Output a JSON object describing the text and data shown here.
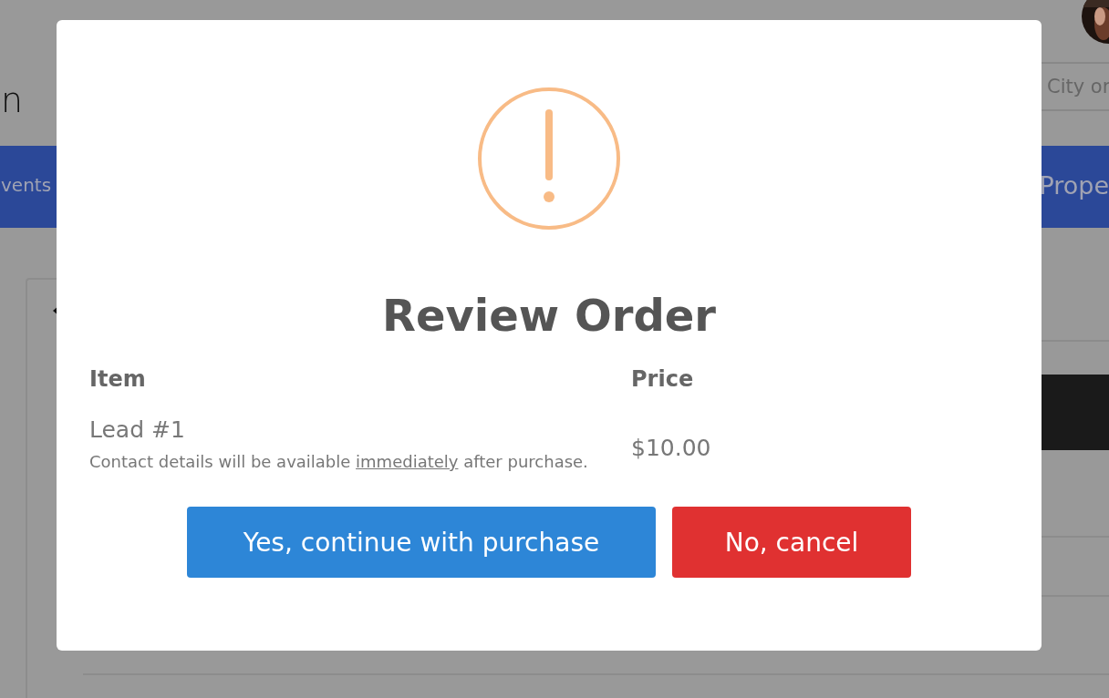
{
  "background": {
    "logo_fragment": "n",
    "search": {
      "placeholder": "City or"
    },
    "nav": [
      {
        "label": "vents"
      },
      {
        "label": "Prope"
      }
    ]
  },
  "dialog": {
    "title": "Review Order",
    "columns": [
      "Item",
      "Price"
    ],
    "rows": [
      {
        "item": "Lead #1",
        "note": {
          "before": "Contact details will be available ",
          "underlined": "immediately",
          "after": " after purchase."
        },
        "price": "$10.00"
      }
    ],
    "buttons": [
      {
        "label": "Yes, continue with purchase",
        "kind": "confirm"
      },
      {
        "label": "No, cancel",
        "kind": "cancel"
      }
    ]
  }
}
